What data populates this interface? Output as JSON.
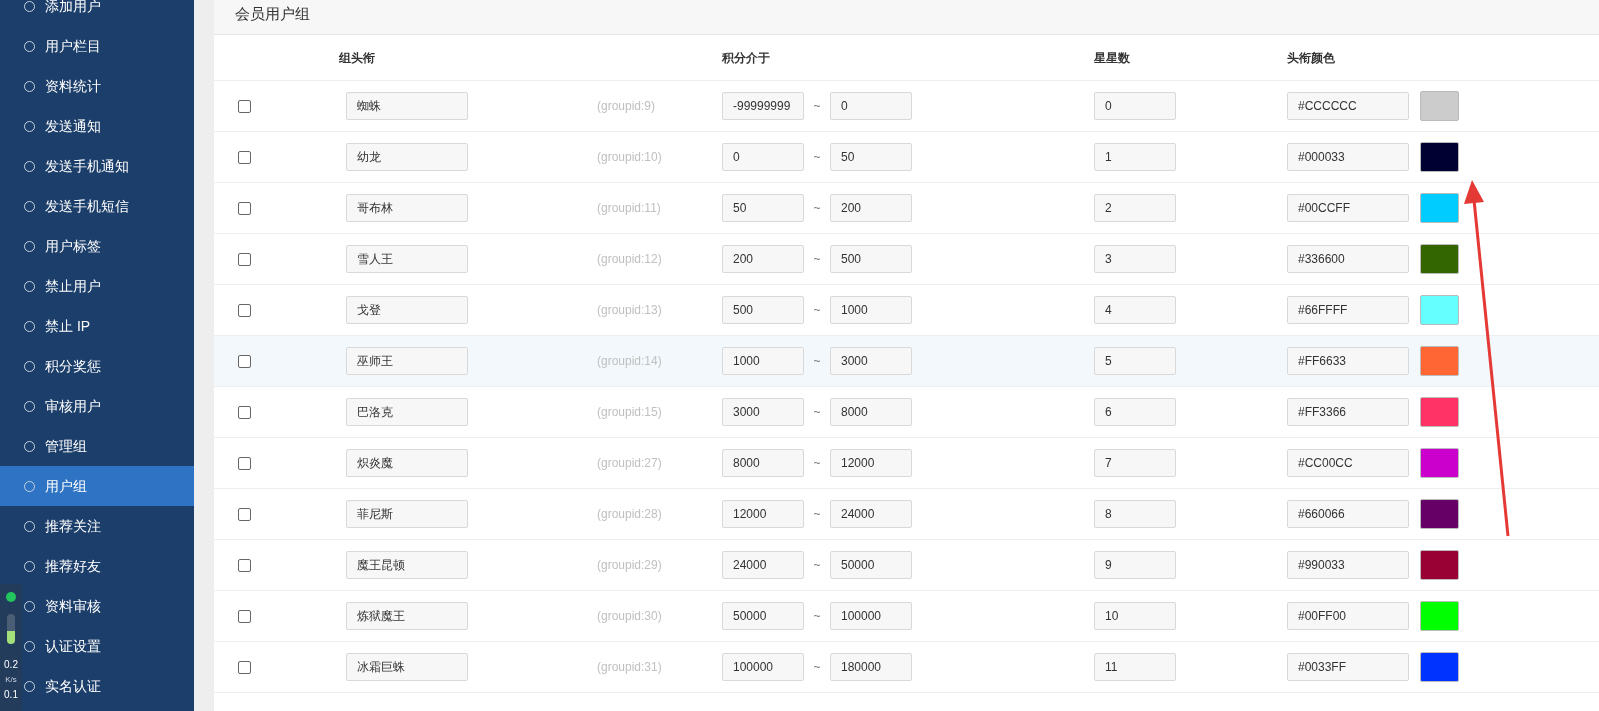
{
  "sidebar": {
    "items": [
      {
        "label": "添加用户",
        "selected": false
      },
      {
        "label": "用户栏目",
        "selected": false
      },
      {
        "label": "资料统计",
        "selected": false
      },
      {
        "label": "发送通知",
        "selected": false
      },
      {
        "label": "发送手机通知",
        "selected": false
      },
      {
        "label": "发送手机短信",
        "selected": false
      },
      {
        "label": "用户标签",
        "selected": false
      },
      {
        "label": "禁止用户",
        "selected": false
      },
      {
        "label": "禁止 IP",
        "selected": false
      },
      {
        "label": "积分奖惩",
        "selected": false
      },
      {
        "label": "审核用户",
        "selected": false
      },
      {
        "label": "管理组",
        "selected": false
      },
      {
        "label": "用户组",
        "selected": true
      },
      {
        "label": "推荐关注",
        "selected": false
      },
      {
        "label": "推荐好友",
        "selected": false
      },
      {
        "label": "资料审核",
        "selected": false
      },
      {
        "label": "认证设置",
        "selected": false
      },
      {
        "label": "实名认证",
        "selected": false
      }
    ]
  },
  "speed_widget": {
    "level": 0.45,
    "upload": "0.2",
    "unit": "K/s",
    "download": "0.1"
  },
  "section_title": "会员用户组",
  "table": {
    "columns": [
      "组头衔",
      "积分介于",
      "星星数",
      "头衔颜色"
    ],
    "separator": "~",
    "rows": [
      {
        "checked": false,
        "hovered": false,
        "title": "蜘蛛",
        "groupid": "(groupid:9)",
        "min": "-99999999",
        "max": "0",
        "stars": "0",
        "color_text": "#CCCCCC",
        "color": "#cccccc"
      },
      {
        "checked": false,
        "hovered": false,
        "title": "幼龙",
        "groupid": "(groupid:10)",
        "min": "0",
        "max": "50",
        "stars": "1",
        "color_text": "#000033",
        "color": "#000033"
      },
      {
        "checked": false,
        "hovered": false,
        "title": "哥布林",
        "groupid": "(groupid:11)",
        "min": "50",
        "max": "200",
        "stars": "2",
        "color_text": "#00CCFF",
        "color": "#00ccff"
      },
      {
        "checked": false,
        "hovered": false,
        "title": "雪人王",
        "groupid": "(groupid:12)",
        "min": "200",
        "max": "500",
        "stars": "3",
        "color_text": "#336600",
        "color": "#336600"
      },
      {
        "checked": false,
        "hovered": false,
        "title": "戈登",
        "groupid": "(groupid:13)",
        "min": "500",
        "max": "1000",
        "stars": "4",
        "color_text": "#66FFFF",
        "color": "#66ffff"
      },
      {
        "checked": false,
        "hovered": true,
        "title": "巫师王",
        "groupid": "(groupid:14)",
        "min": "1000",
        "max": "3000",
        "stars": "5",
        "color_text": "#FF6633",
        "color": "#ff6633"
      },
      {
        "checked": false,
        "hovered": false,
        "title": "巴洛克",
        "groupid": "(groupid:15)",
        "min": "3000",
        "max": "8000",
        "stars": "6",
        "color_text": "#FF3366",
        "color": "#ff3366"
      },
      {
        "checked": false,
        "hovered": false,
        "title": "炽炎魔",
        "groupid": "(groupid:27)",
        "min": "8000",
        "max": "12000",
        "stars": "7",
        "color_text": "#CC00CC",
        "color": "#cc00cc"
      },
      {
        "checked": false,
        "hovered": false,
        "title": "菲尼斯",
        "groupid": "(groupid:28)",
        "min": "12000",
        "max": "24000",
        "stars": "8",
        "color_text": "#660066",
        "color": "#660066"
      },
      {
        "checked": false,
        "hovered": false,
        "title": "魔王昆顿",
        "groupid": "(groupid:29)",
        "min": "24000",
        "max": "50000",
        "stars": "9",
        "color_text": "#990033",
        "color": "#990033"
      },
      {
        "checked": false,
        "hovered": false,
        "title": "炼狱魔王",
        "groupid": "(groupid:30)",
        "min": "50000",
        "max": "100000",
        "stars": "10",
        "color_text": "#00FF00",
        "color": "#00ff00"
      },
      {
        "checked": false,
        "hovered": false,
        "title": "冰霜巨蛛",
        "groupid": "(groupid:31)",
        "min": "100000",
        "max": "180000",
        "stars": "11",
        "color_text": "#0033FF",
        "color": "#0033ff"
      }
    ]
  }
}
